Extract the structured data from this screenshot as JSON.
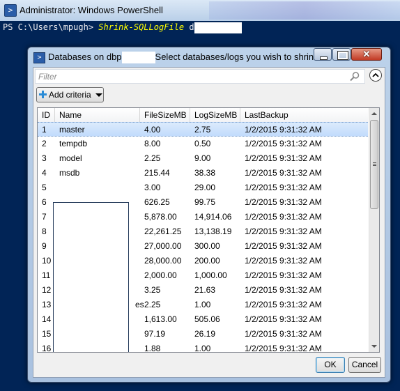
{
  "ps_window": {
    "title": "Administrator: Windows PowerShell",
    "prompt": "PS C:\\Users\\mpugh> ",
    "command": "Shrink-SQLLogFile",
    "argument_prefix": " d"
  },
  "dialog": {
    "title_prefix": "Databases on dbp",
    "title_suffix": "Select databases/logs you wish to shrink",
    "close_glyph": "✕",
    "filter_placeholder": "Filter",
    "add_criteria_label": "Add criteria",
    "columns": [
      "ID",
      "Name",
      "FileSizeMB",
      "LogSizeMB",
      "LastBackup"
    ],
    "rows": [
      {
        "id": "1",
        "name": "master",
        "file": "4.00",
        "log": "2.75",
        "backup": "1/2/2015 9:31:32 AM",
        "selected": true
      },
      {
        "id": "2",
        "name": "tempdb",
        "file": "8.00",
        "log": "0.50",
        "backup": "1/2/2015 9:31:32 AM"
      },
      {
        "id": "3",
        "name": "model",
        "file": "2.25",
        "log": "9.00",
        "backup": "1/2/2015 9:31:32 AM"
      },
      {
        "id": "4",
        "name": "msdb",
        "file": "215.44",
        "log": "38.38",
        "backup": "1/2/2015 9:31:32 AM"
      },
      {
        "id": "5",
        "name": "",
        "file": "3.00",
        "log": "29.00",
        "backup": "1/2/2015 9:31:32 AM"
      },
      {
        "id": "6",
        "name": "",
        "file": "626.25",
        "log": "99.75",
        "backup": "1/2/2015 9:31:32 AM"
      },
      {
        "id": "7",
        "name": "",
        "file": "5,878.00",
        "log": "14,914.06",
        "backup": "1/2/2015 9:31:32 AM"
      },
      {
        "id": "8",
        "name": "",
        "file": "22,261.25",
        "log": "13,138.19",
        "backup": "1/2/2015 9:31:32 AM"
      },
      {
        "id": "9",
        "name": "",
        "file": "27,000.00",
        "log": "300.00",
        "backup": "1/2/2015 9:31:32 AM"
      },
      {
        "id": "10",
        "name": "",
        "file": "28,000.00",
        "log": "200.00",
        "backup": "1/2/2015 9:31:32 AM"
      },
      {
        "id": "11",
        "name": "",
        "file": "2,000.00",
        "log": "1,000.00",
        "backup": "1/2/2015 9:31:32 AM"
      },
      {
        "id": "12",
        "name": "",
        "file": "3.25",
        "log": "21.63",
        "backup": "1/2/2015 9:31:32 AM"
      },
      {
        "id": "13",
        "name": "es",
        "file": "2.25",
        "log": "1.00",
        "backup": "1/2/2015 9:31:32 AM"
      },
      {
        "id": "14",
        "name": "",
        "file": "1,613.00",
        "log": "505.06",
        "backup": "1/2/2015 9:31:32 AM"
      },
      {
        "id": "15",
        "name": "",
        "file": "97.19",
        "log": "26.19",
        "backup": "1/2/2015 9:31:32 AM"
      },
      {
        "id": "16",
        "name": "",
        "file": "1.88",
        "log": "1.00",
        "backup": "1/2/2015 9:31:32 AM"
      }
    ],
    "ok_label": "OK",
    "cancel_label": "Cancel"
  },
  "colors": {
    "console_bg": "#012456",
    "command_yellow": "#ffff00",
    "selection": "#c1dbfc"
  },
  "icons": [
    "powershell-icon",
    "search-icon",
    "chevron-up-icon",
    "plus-icon",
    "dropdown-arrow-icon"
  ]
}
